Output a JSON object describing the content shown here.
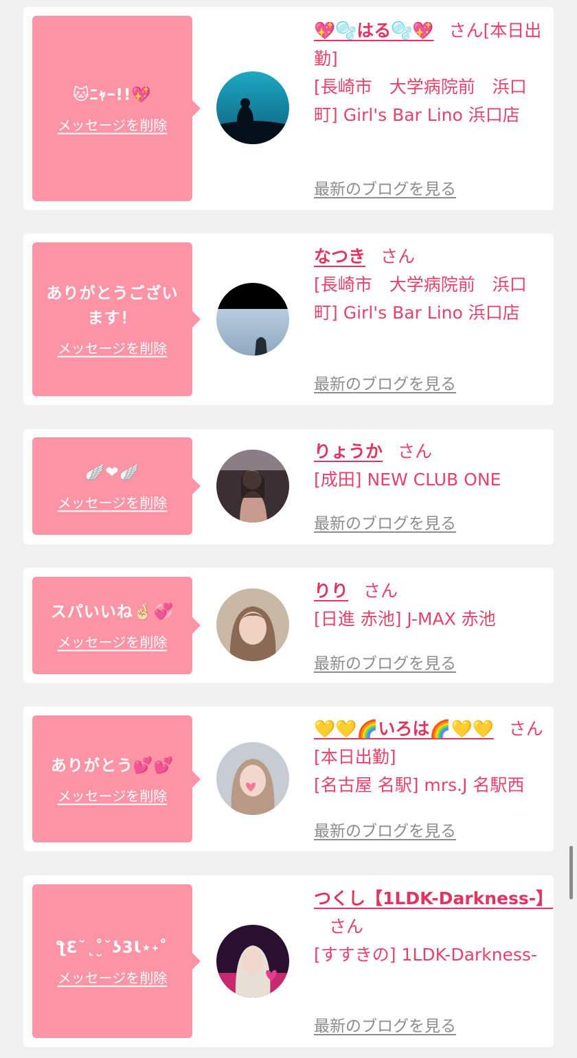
{
  "delete_label": "メッセージを削除",
  "blog_label": "最新のブログを見る",
  "entries": [
    {
      "message": "🐱ﾆｬｰ!!💖",
      "name": "💖🫧はる🫧💖",
      "suffix": "さん[本日出勤]",
      "shop": "[長崎市　大学病院前　浜口町] Girl's Bar Lino 浜口店",
      "avatar": "aquarium-silhouette"
    },
    {
      "message": "ありがとうございます！",
      "name": "なつき",
      "suffix": "さん",
      "shop": "[長崎市　大学病院前　浜口町] Girl's Bar Lino 浜口店",
      "avatar": "sea-view"
    },
    {
      "message": "🪽❤🪽",
      "name": "りょうか",
      "suffix": "さん",
      "shop": "[成田] NEW CLUB ONE",
      "avatar": "mirror-selfie"
    },
    {
      "message": "スパいいね🤞🏻💞",
      "name": "りり",
      "suffix": "さん",
      "shop": "[日進 赤池] J-MAX 赤池",
      "avatar": "portrait"
    },
    {
      "message": "ありがとう💕💕",
      "name": "💛💛🌈いろは🌈💛💛",
      "suffix": "さん[本日出勤]",
      "shop": "[名古屋 名駅] mrs.J 名駅西",
      "avatar": "portrait-heart"
    },
    {
      "message": "ƪƐ˘˛˚̮˘ʖ3Ɩ⋆˖˚",
      "name": "つくし【1LDK-Darkness-】",
      "suffix": "さん",
      "shop": "[すすきの] 1LDK-Darkness-",
      "avatar": "dark-photo"
    }
  ],
  "colors": {
    "bubble": "#fd94a6",
    "name": "#e0355f",
    "shop": "#e5426a",
    "blog": "#8c8c8c",
    "background": "#f1f1f2"
  }
}
